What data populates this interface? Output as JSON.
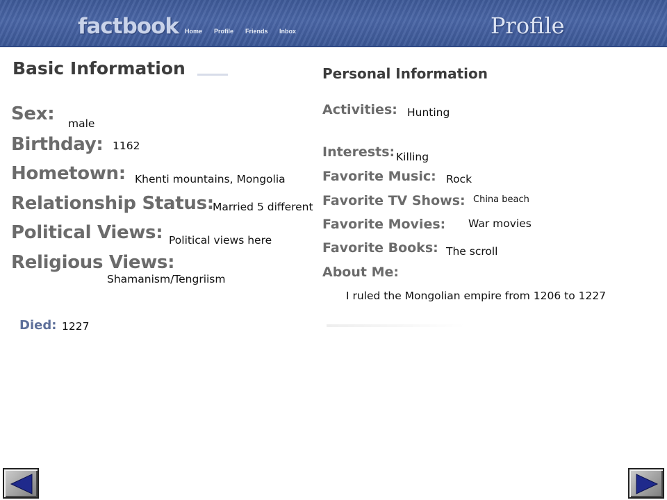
{
  "header": {
    "logo": "factbook",
    "nav": [
      "Home",
      "Profile",
      "Friends",
      "Inbox"
    ],
    "title": "Profile"
  },
  "basic_info": {
    "heading": "Basic Information",
    "sex_label": "Sex:",
    "sex_value": "male",
    "birthday_label": "Birthday:",
    "birthday_value": "1162",
    "hometown_label": "Hometown:",
    "hometown_value": "Khenti mountains, Mongolia",
    "relationship_label": "Relationship Status:",
    "relationship_value": "Married 5 different",
    "political_label": "Political Views:",
    "political_value": "Political views here",
    "religious_label": "Religious Views:",
    "religious_value": "Shamanism/Tengriism",
    "died_label": "Died:",
    "died_value": "1227"
  },
  "personal_info": {
    "heading": "Personal Information",
    "activities_label": "Activities:",
    "activities_value": "Hunting",
    "interests_label": "Interests:",
    "interests_value": "Killing",
    "music_label": "Favorite Music:",
    "music_value": "Rock",
    "tv_label": "Favorite TV Shows:",
    "tv_value": "China beach",
    "movies_label": "Favorite Movies:",
    "movies_value": "War movies",
    "books_label": "Favorite Books:",
    "books_value": "The scroll",
    "about_label": "About Me:",
    "about_value": "I ruled the Mongolian empire from 1206 to 1227"
  },
  "navigation": {
    "prev_icon": "triangle-left-icon",
    "next_icon": "triangle-right-icon",
    "arrow_color": "#1f2a8c"
  }
}
